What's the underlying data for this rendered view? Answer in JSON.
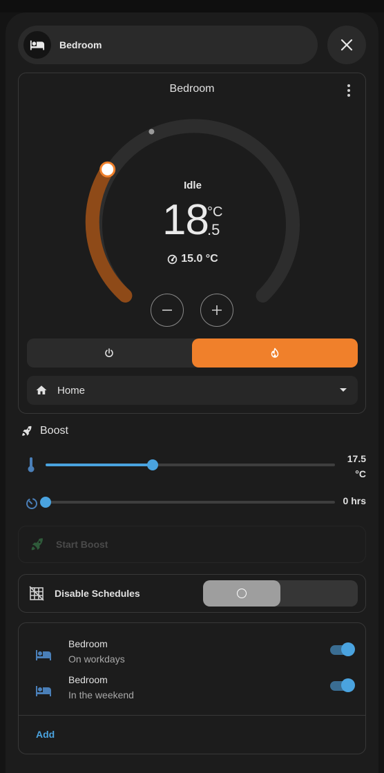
{
  "header": {
    "title": "Bedroom",
    "avatar_icon": "bed-icon",
    "close_icon": "close-icon"
  },
  "thermostat": {
    "title": "Bedroom",
    "state": "Idle",
    "target_int": "18",
    "target_unit": "°C",
    "target_decimal": ".5",
    "current_temp": "15.0 °C",
    "target_value": 18.5,
    "accent_color": "#f0802b"
  },
  "modes": {
    "off_icon": "power-icon",
    "heat_icon": "flame-icon",
    "active": "heat"
  },
  "preset": {
    "icon": "home-icon",
    "value": "Home"
  },
  "boost": {
    "title": "Boost",
    "temp_value_line1": "17.5",
    "temp_value_line2": "°C",
    "temp_fraction": 0.37,
    "time_value": "0 hrs",
    "time_fraction": 0.0,
    "start_label": "Start Boost"
  },
  "schedules": {
    "disable_label": "Disable Schedules",
    "items": [
      {
        "name": "Bedroom",
        "subtitle": "On workdays",
        "enabled": true
      },
      {
        "name": "Bedroom",
        "subtitle": "In the weekend",
        "enabled": true
      }
    ],
    "add_label": "Add"
  },
  "colors": {
    "accent": "#f0802b",
    "blue": "#4aa3df",
    "background": "#1c1c1c"
  }
}
